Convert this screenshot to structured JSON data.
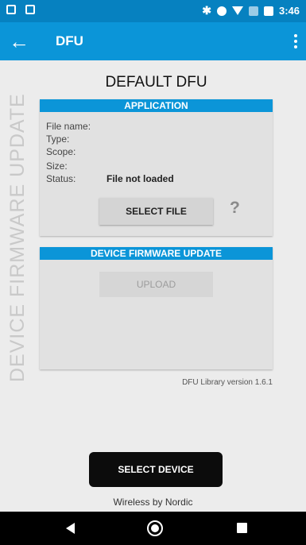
{
  "status_bar": {
    "time": "3:46",
    "icons": [
      "image-icon",
      "notification-icon",
      "bluetooth-icon",
      "dnd-icon",
      "wifi-icon",
      "signal-icon",
      "battery-icon"
    ]
  },
  "app_bar": {
    "title": "DFU",
    "back_glyph": "←"
  },
  "vertical_title": "DEVICE FIRMWARE UPDATE",
  "heading": "DEFAULT DFU",
  "application_panel": {
    "header": "APPLICATION",
    "rows": [
      {
        "label": "File name:",
        "value": ""
      },
      {
        "label": "Type:",
        "value": ""
      },
      {
        "label": "Scope:",
        "value": ""
      },
      {
        "label": "Size:",
        "value": ""
      },
      {
        "label": "Status:",
        "value": "File not loaded"
      }
    ],
    "select_file_label": "SELECT FILE",
    "help_glyph": "?"
  },
  "dfu_panel": {
    "header": "DEVICE FIRMWARE UPDATE",
    "upload_label": "UPLOAD"
  },
  "library_version": "DFU Library version 1.6.1",
  "select_device_label": "SELECT DEVICE",
  "footer": "Wireless by Nordic",
  "colors": {
    "status_bar": "#0681c0",
    "app_bar": "#0b95d8",
    "panel_header": "#0b95d8",
    "background": "#ececec"
  }
}
